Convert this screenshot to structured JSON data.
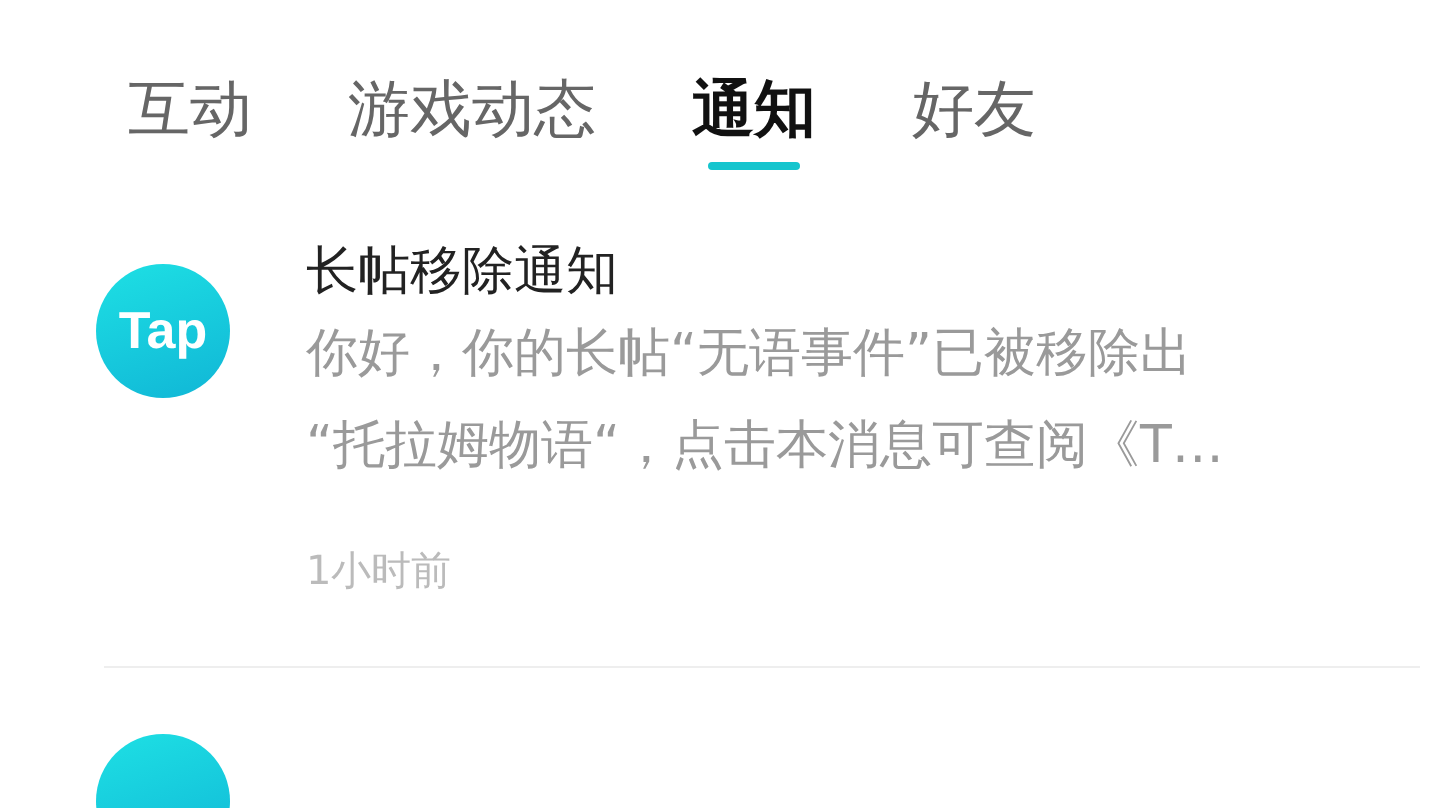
{
  "tabs": [
    {
      "label": "互动",
      "selected": false
    },
    {
      "label": "游戏动态",
      "selected": false
    },
    {
      "label": "通知",
      "selected": true
    },
    {
      "label": "好友",
      "selected": false
    }
  ],
  "notifications": [
    {
      "avatar": "Tap",
      "title": "长帖移除通知",
      "lines": [
        "你好，你的长帖“无语事件”已被移除出",
        "“托拉姆物语“，点击本消息可查阅《T…"
      ],
      "time": "1小时前"
    }
  ]
}
